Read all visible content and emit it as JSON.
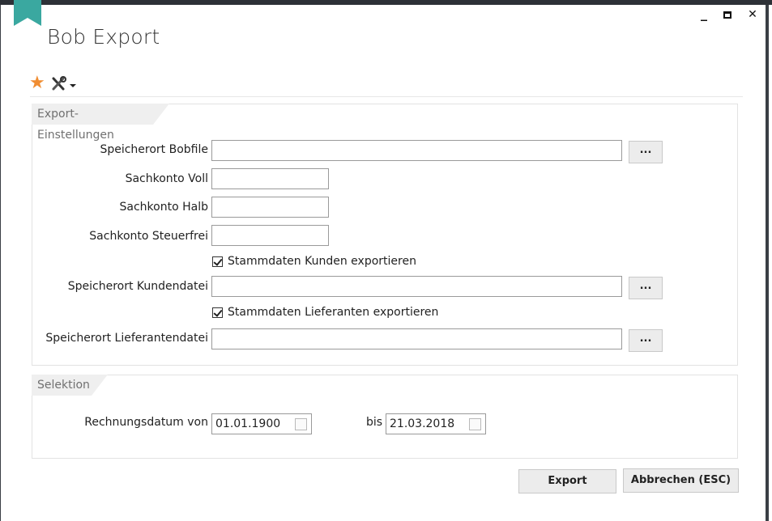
{
  "window": {
    "title": "Bob Export",
    "minimize_glyph": "_",
    "maximize_glyph": "☐",
    "close_glyph": "✕"
  },
  "toolbar": {
    "favorite_icon": "star-icon",
    "tools_icon": "tools-icon",
    "accent_color": "#f08d32"
  },
  "export_settings": {
    "title": "Export-Einstellungen",
    "bobfile_label": "Speicherort Bobfile",
    "bobfile_value": "",
    "browse_label": "...",
    "sachkonto_voll_label": "Sachkonto Voll",
    "sachkonto_voll_value": "",
    "sachkonto_halb_label": "Sachkonto Halb",
    "sachkonto_halb_value": "",
    "sachkonto_steuerfrei_label": "Sachkonto Steuerfrei",
    "sachkonto_steuerfrei_value": "",
    "kunden_checkbox_label": "Stammdaten Kunden exportieren",
    "kunden_checked": true,
    "kundendatei_label": "Speicherort Kundendatei",
    "kundendatei_value": "",
    "lieferanten_checkbox_label": "Stammdaten Lieferanten exportieren",
    "lieferanten_checked": true,
    "lieferantendatei_label": "Speicherort Lieferantendatei",
    "lieferantendatei_value": ""
  },
  "selektion": {
    "title": "Selektion",
    "rechnungsdatum_label": "Rechnungsdatum  von",
    "date_from": "01.01.1900",
    "bis_label": "bis",
    "date_to": "21.03.2018"
  },
  "actions": {
    "export_label": "Export",
    "cancel_label": "Abbrechen (ESC)"
  }
}
